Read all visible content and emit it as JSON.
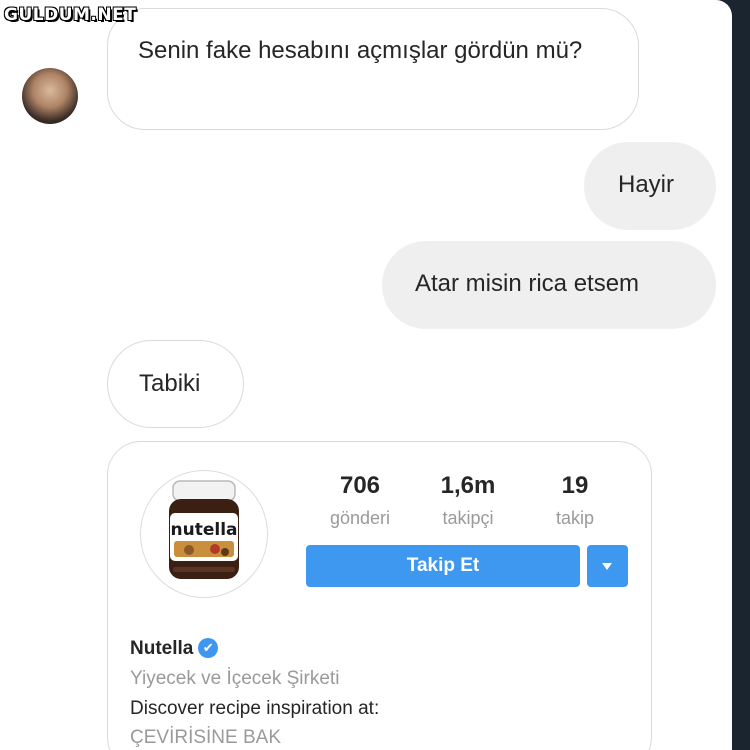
{
  "watermark": "GULDUM.NET",
  "conversation": {
    "messages": [
      {
        "side": "incoming",
        "text": "Senin fake hesabını açmışlar gördün mü?"
      },
      {
        "side": "outgoing",
        "text": "Hayir"
      },
      {
        "side": "outgoing",
        "text": "Atar misin rica etsem"
      },
      {
        "side": "incoming",
        "text": "Tabiki"
      }
    ]
  },
  "shared_profile": {
    "logo_text": "nutella",
    "stats": [
      {
        "value": "706",
        "label": "gönderi"
      },
      {
        "value": "1,6m",
        "label": "takipçi"
      },
      {
        "value": "19",
        "label": "takip"
      }
    ],
    "follow_label": "Takip Et",
    "name": "Nutella",
    "verified_icon": "✔",
    "category": "Yiyecek ve İçecek Şirketi",
    "bio": "Discover recipe inspiration at:",
    "translate_label": "ÇEVİRİSİNE BAK"
  },
  "colors": {
    "accent": "#3f98ef",
    "background": "#1b2530",
    "outgoing_bubble": "#efefef",
    "muted_text": "#9a9a9a"
  }
}
